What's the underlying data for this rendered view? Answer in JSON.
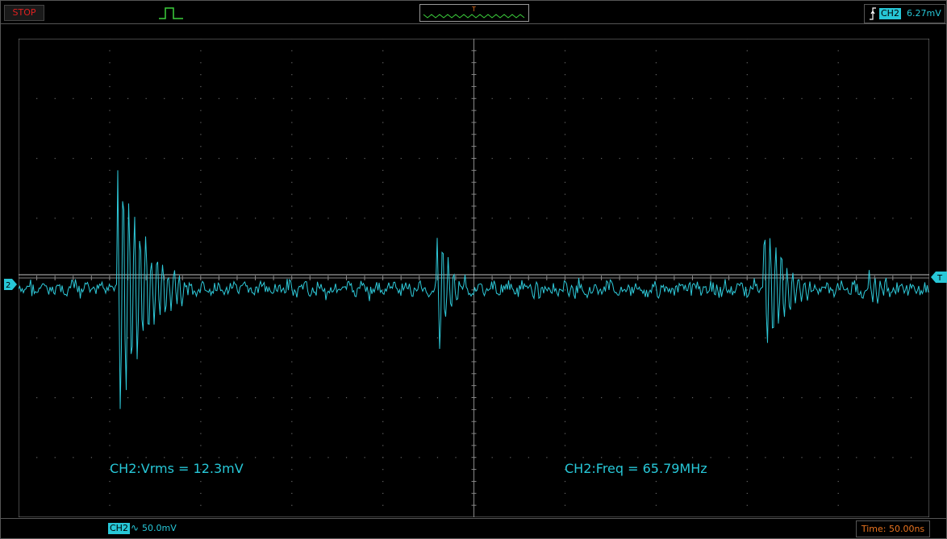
{
  "status": {
    "run_state": "STOP"
  },
  "trigger": {
    "channel": "CH2",
    "level": "6.27mV",
    "marker_channel": "2",
    "marker_trigger": "T"
  },
  "overview": {
    "trigger_mark": "T"
  },
  "measurements": [
    {
      "text": "CH2:Vrms = 12.3mV"
    },
    {
      "text": "CH2:Freq = 65.79MHz"
    }
  ],
  "channel_settings": {
    "channel": "CH2",
    "coupling_icon": "ac-coupling-icon",
    "volts_per_div": "50.0mV"
  },
  "timebase": {
    "text": "Time: 50.00ns"
  },
  "colors": {
    "trace": "#2ec9d9",
    "grid": "#666666",
    "stop": "#e02020",
    "time": "#e8731f"
  },
  "grid": {
    "h_divisions": 10,
    "v_divisions": 8
  }
}
